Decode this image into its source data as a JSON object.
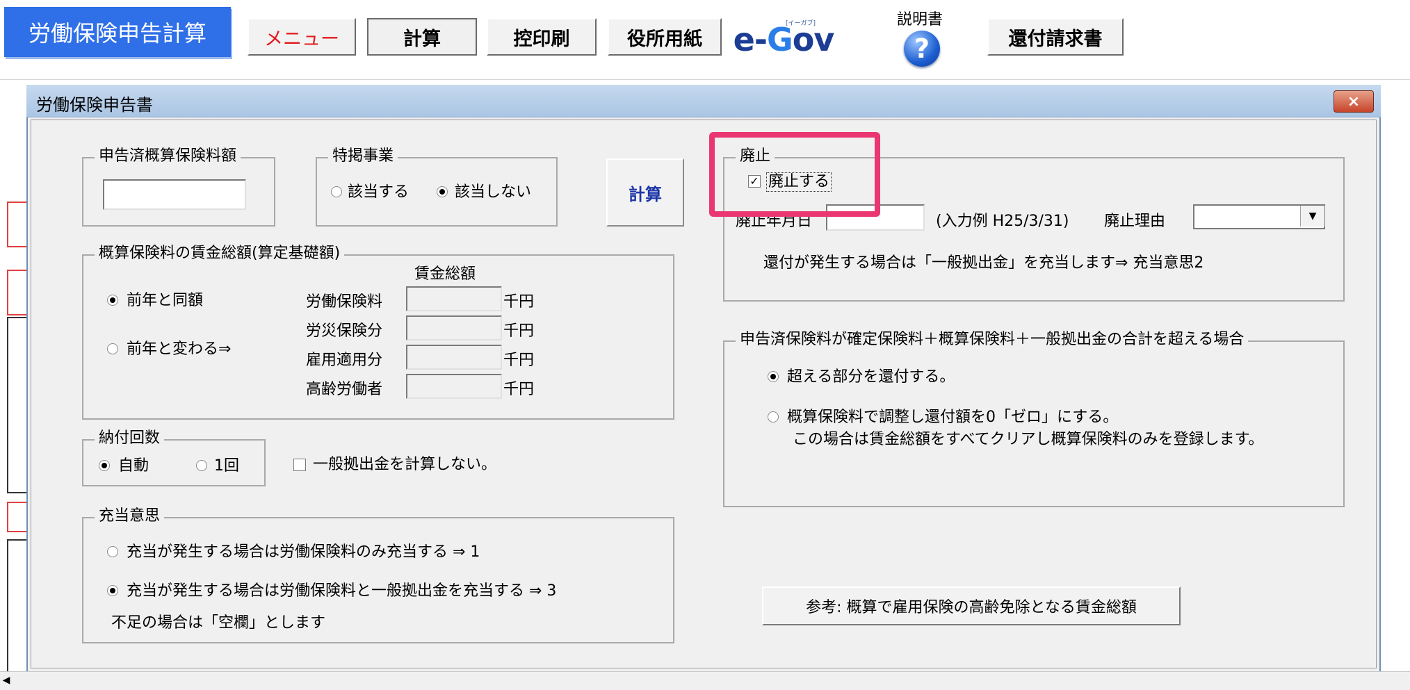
{
  "toolbar": {
    "app_title": "労働保険申告計算",
    "menu": "メニュー",
    "calc": "計算",
    "print": "控印刷",
    "office_form": "役所用紙",
    "egov_e": "e-",
    "egov_g": "G",
    "egov_ov": "ov",
    "egov_sub": "[イーガブ]",
    "help_label": "説明書",
    "help_icon": "?",
    "refund": "還付請求書"
  },
  "dialog": {
    "title": "労働保険申告書",
    "close": "×",
    "declared": {
      "label": "申告済概算保険料額",
      "value": ""
    },
    "special": {
      "label": "特掲事業",
      "opt_yes": "該当する",
      "opt_no": "該当しない",
      "selected": "該当しない"
    },
    "calc_button": "計算",
    "wage_group": {
      "label": "概算保険料の賃金総額(算定基礎額)",
      "header": "賃金総額",
      "opt_same": "前年と同額",
      "opt_change": "前年と変わる⇒",
      "selected": "前年と同額",
      "rows": [
        {
          "label": "労働保険料",
          "value": "",
          "unit": "千円"
        },
        {
          "label": "労災保険分",
          "value": "",
          "unit": "千円"
        },
        {
          "label": "雇用適用分",
          "value": "",
          "unit": "千円"
        },
        {
          "label": "高齢労働者",
          "value": "",
          "unit": "千円"
        }
      ]
    },
    "payment": {
      "label": "納付回数",
      "opt_auto": "自動",
      "opt_once": "1回",
      "selected": "自動",
      "no_general": "一般拠出金を計算しない。",
      "no_general_checked": false
    },
    "allocation": {
      "label": "充当意思",
      "opt1": "充当が発生する場合は労働保険料のみ充当する ⇒ 1",
      "opt3": "充当が発生する場合は労働保険料と一般拠出金を充当する ⇒ 3",
      "selected": 3,
      "note": "不足の場合は「空欄」とします"
    },
    "abolish": {
      "label": "廃止",
      "check_label": "廃止する",
      "checked": true,
      "date_label": "廃止年月日",
      "date_value": "",
      "example": "(入力例  H25/3/31)",
      "reason_label": "廃止理由",
      "reason_value": "",
      "note": "還付が発生する場合は「一般拠出金」を充当します⇒  充当意思2"
    },
    "excess": {
      "label": "申告済保険料が確定保険料＋概算保険料＋一般拠出金の合計を超える場合",
      "opt_refund": "超える部分を還付する。",
      "opt_adjust": "概算保険料で調整し還付額を0「ゼロ」にする。",
      "opt_adjust_note": "この場合は賃金総額をすべてクリアし概算保険料のみを登録します。",
      "selected": "refund"
    },
    "reference_button": "参考:  概算で雇用保険の高齢免除となる賃金総額"
  },
  "colors": {
    "title_blue": "#2f6fe8",
    "menu_red": "#e3191c",
    "highlight": "#ea3671",
    "calc_text": "#1d36a8"
  }
}
